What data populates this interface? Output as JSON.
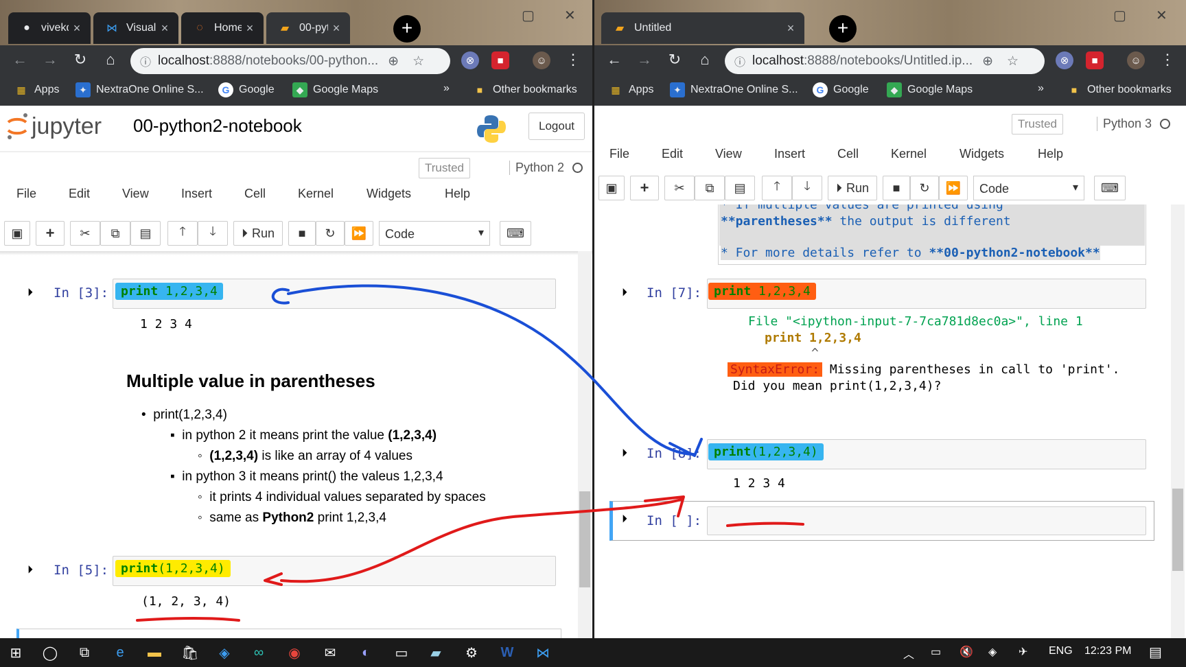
{
  "left_window": {
    "tabs": [
      {
        "label": "vivekd…",
        "icon": "github-icon"
      },
      {
        "label": "Visual S",
        "icon": "vscode-icon"
      },
      {
        "label": "Home",
        "icon": "jupyter-icon"
      },
      {
        "label": "00-pyt…",
        "icon": "notebook-icon"
      }
    ],
    "url_host": "localhost",
    "url_path": ":8888/notebooks/00-python...",
    "bookmarks": {
      "apps": "Apps",
      "nextra": "NextraOne Online S...",
      "google": "Google",
      "maps": "Google Maps",
      "more": "»",
      "other": "Other bookmarks"
    },
    "jupyter": {
      "logo_text": "jupyter",
      "notebook_title": "00-python2-notebook",
      "logout": "Logout",
      "trusted": "Trusted",
      "kernel": "Python 2",
      "menus": [
        "File",
        "Edit",
        "View",
        "Insert",
        "Cell",
        "Kernel",
        "Widgets",
        "Help"
      ],
      "cell_type": "Code",
      "run_label": "Run"
    },
    "cells": {
      "c3_prompt": "In [3]:",
      "c3_code_kw": "print",
      "c3_code_rest": " 1,2,3,4",
      "c3_out": "1 2 3 4",
      "md_heading": "Multiple value in parentheses",
      "md_l1": "print(1,2,3,4)",
      "md_l2a": "in python 2 it means print the value ",
      "md_l2b": "(1,2,3,4)",
      "md_l3a": "(1,2,3,4)",
      "md_l3b": " is like an array of 4 values",
      "md_l4": "in python 3 it means print() the valeus 1,2,3,4",
      "md_l5": "it prints 4 individual values separated by spaces",
      "md_l6a": "same as ",
      "md_l6b": "Python2",
      "md_l6c": " print 1,2,3,4",
      "c5_prompt": "In [5]:",
      "c5_code_kw": "print",
      "c5_code_rest": "(1,2,3,4)",
      "c5_out": "(1, 2, 3, 4)"
    }
  },
  "right_window": {
    "tab_label": "Untitled",
    "url_host": "localhost",
    "url_path": ":8888/notebooks/Untitled.ip...",
    "bookmarks": {
      "apps": "Apps",
      "nextra": "NextraOne Online S...",
      "google": "Google",
      "maps": "Google Maps",
      "more": "»",
      "other": "Other bookmarks"
    },
    "jupyter": {
      "trusted": "Trusted",
      "kernel": "Python 3",
      "menus": [
        "File",
        "Edit",
        "View",
        "Insert",
        "Cell",
        "Kernel",
        "Widgets",
        "Help"
      ],
      "cell_type": "Code",
      "run_label": "Run"
    },
    "cells": {
      "md_line0": "* If multiple values are printed using",
      "md_line1a": "**parentheses**",
      "md_line1b": " the output is different",
      "md_line2a": "* For more details refer to ",
      "md_line2b": "**00-python2-notebook**",
      "c7_prompt": "In [7]:",
      "c7_code_kw": "print",
      "c7_code_rest": " 1,2,3,4",
      "c7_err_file": "File \"<ipython-input-7-7ca781d8ec0a>\", line 1",
      "c7_err_code": "print 1,2,3,4",
      "c7_err_caret": "^",
      "c7_err_name": "SyntaxError:",
      "c7_err_msg1": " Missing parentheses in call to 'print'.",
      "c7_err_msg2": "Did you mean print(1,2,3,4)?",
      "c8_prompt": "In [8]:",
      "c8_code_kw": "print",
      "c8_code_rest": "(1,2,3,4)",
      "c8_out": "1 2 3 4",
      "c9_prompt": "In [ ]:"
    }
  },
  "taskbar": {
    "lang": "ENG",
    "time": "12:23 PM"
  },
  "colors": {
    "highlight_blue": "#37b5f0",
    "highlight_yellow": "#ffeb00",
    "highlight_orange": "#ff5e12",
    "arrow_blue": "#1a4fd6",
    "arrow_red": "#e01a1a"
  }
}
